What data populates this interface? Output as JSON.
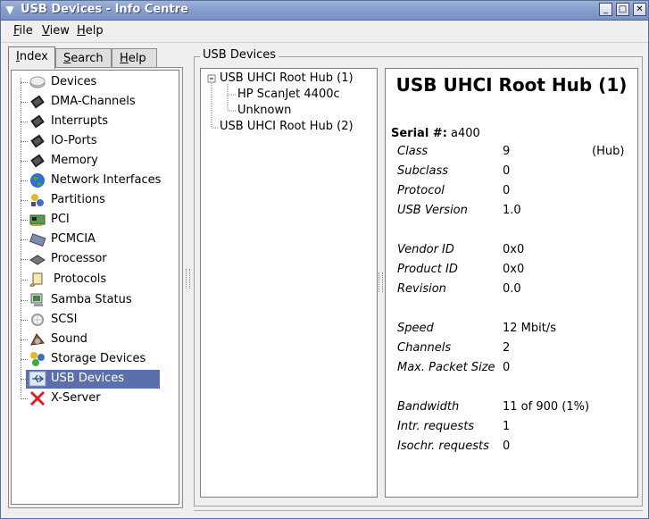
{
  "window": {
    "title": "USB Devices - Info Centre",
    "menu_glyph": "▼",
    "btn_minimize": "_",
    "btn_maximize": "□",
    "btn_close": "✕"
  },
  "menu": {
    "file": {
      "key": "F",
      "rest": "ile"
    },
    "view": {
      "key": "V",
      "rest": "iew"
    },
    "help": {
      "key": "H",
      "rest": "elp"
    }
  },
  "tabs": {
    "index": {
      "key": "I",
      "rest": "ndex"
    },
    "search": {
      "key": "S",
      "rest": "earch"
    },
    "help": {
      "key": "H",
      "rest": "elp"
    }
  },
  "index_items": [
    {
      "label": "Devices",
      "icon": "devices-icon"
    },
    {
      "label": "DMA-Channels",
      "icon": "chip-icon"
    },
    {
      "label": "Interrupts",
      "icon": "chip-icon"
    },
    {
      "label": "IO-Ports",
      "icon": "chip-icon"
    },
    {
      "label": "Memory",
      "icon": "chip-icon"
    },
    {
      "label": "Network Interfaces",
      "icon": "globe-icon"
    },
    {
      "label": "Partitions",
      "icon": "partitions-icon"
    },
    {
      "label": "PCI",
      "icon": "pci-card-icon"
    },
    {
      "label": "PCMCIA",
      "icon": "pcmcia-card-icon"
    },
    {
      "label": "Processor",
      "icon": "processor-icon"
    },
    {
      "label": "Protocols",
      "icon": "scroll-icon"
    },
    {
      "label": "Samba Status",
      "icon": "samba-icon"
    },
    {
      "label": "SCSI",
      "icon": "scsi-icon"
    },
    {
      "label": "Sound",
      "icon": "sound-icon"
    },
    {
      "label": "Storage Devices",
      "icon": "storage-icon"
    },
    {
      "label": "USB Devices",
      "icon": "usb-icon"
    },
    {
      "label": "X-Server",
      "icon": "x-server-icon"
    }
  ],
  "usb": {
    "group_title": "USB Devices",
    "tree": {
      "hub1": "USB UHCI Root Hub (1)",
      "child1": "HP ScanJet 4400c",
      "child2": "Unknown",
      "hub2": "USB UHCI Root Hub (2)"
    },
    "details": {
      "heading": "USB UHCI Root Hub (1)",
      "serial_label": "Serial #:",
      "serial_value": "a400",
      "rows": [
        {
          "k": "Class",
          "v": "9",
          "x": "(Hub)"
        },
        {
          "k": "Subclass",
          "v": "0",
          "x": ""
        },
        {
          "k": "Protocol",
          "v": "0",
          "x": ""
        },
        {
          "k": "USB Version",
          "v": "1.0",
          "x": ""
        },
        {
          "k": "Vendor ID",
          "v": "0x0",
          "x": ""
        },
        {
          "k": "Product ID",
          "v": "0x0",
          "x": ""
        },
        {
          "k": "Revision",
          "v": "0.0",
          "x": ""
        },
        {
          "k": "Speed",
          "v": "12 Mbit/s",
          "x": ""
        },
        {
          "k": "Channels",
          "v": "2",
          "x": ""
        },
        {
          "k": "Max. Packet Size",
          "v": "0",
          "x": ""
        },
        {
          "k": "Bandwidth",
          "v": "11 of 900 (1%)",
          "x": ""
        },
        {
          "k": "Intr. requests",
          "v": "1",
          "x": ""
        },
        {
          "k": "Isochr. requests",
          "v": "0",
          "x": ""
        }
      ]
    }
  },
  "colors": {
    "titlebar": "#8aa1cf",
    "selection": "#5b70aa"
  }
}
